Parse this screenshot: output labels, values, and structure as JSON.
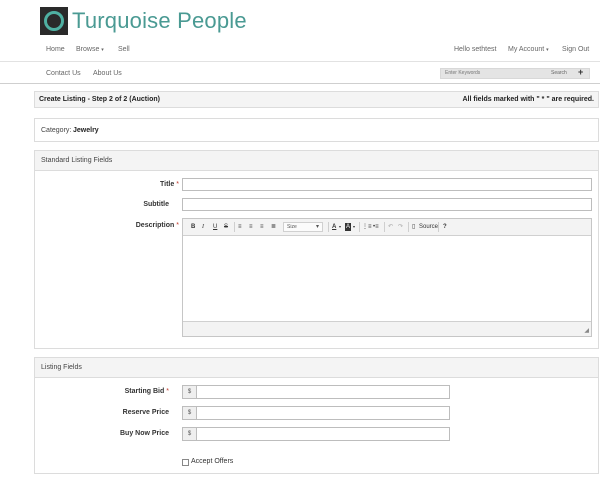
{
  "brand": {
    "name": "Turquoise People",
    "accent": "#4a9a93"
  },
  "nav": {
    "home": "Home",
    "browse": "Browse",
    "sell": "Sell",
    "greeting": "Hello sethtest",
    "my_account": "My Account",
    "sign_out": "Sign Out",
    "contact": "Contact Us",
    "about": "About Us",
    "search_placeholder": "Enter Keywords",
    "search_button": "Search",
    "plus": "+"
  },
  "step": {
    "title": "Create Listing - Step 2 of 2 (Auction)",
    "required_note": "All fields marked with \" * \" are required."
  },
  "category": {
    "label": "Category:",
    "value": "Jewelry"
  },
  "standard": {
    "heading": "Standard Listing Fields",
    "title_label": "Title",
    "subtitle_label": "Subtitle",
    "description_label": "Description",
    "req_mark": "*",
    "toolbar": {
      "bold": "B",
      "italic": "I",
      "underline": "U",
      "strike": "S",
      "size_label": "Size",
      "source": "Source",
      "help": "?"
    }
  },
  "listing": {
    "heading": "Listing Fields",
    "starting_bid": "Starting Bid",
    "reserve_price": "Reserve Price",
    "buy_now_price": "Buy Now Price",
    "currency": "$",
    "accept_offers": "Accept Offers",
    "req_mark": "*"
  }
}
